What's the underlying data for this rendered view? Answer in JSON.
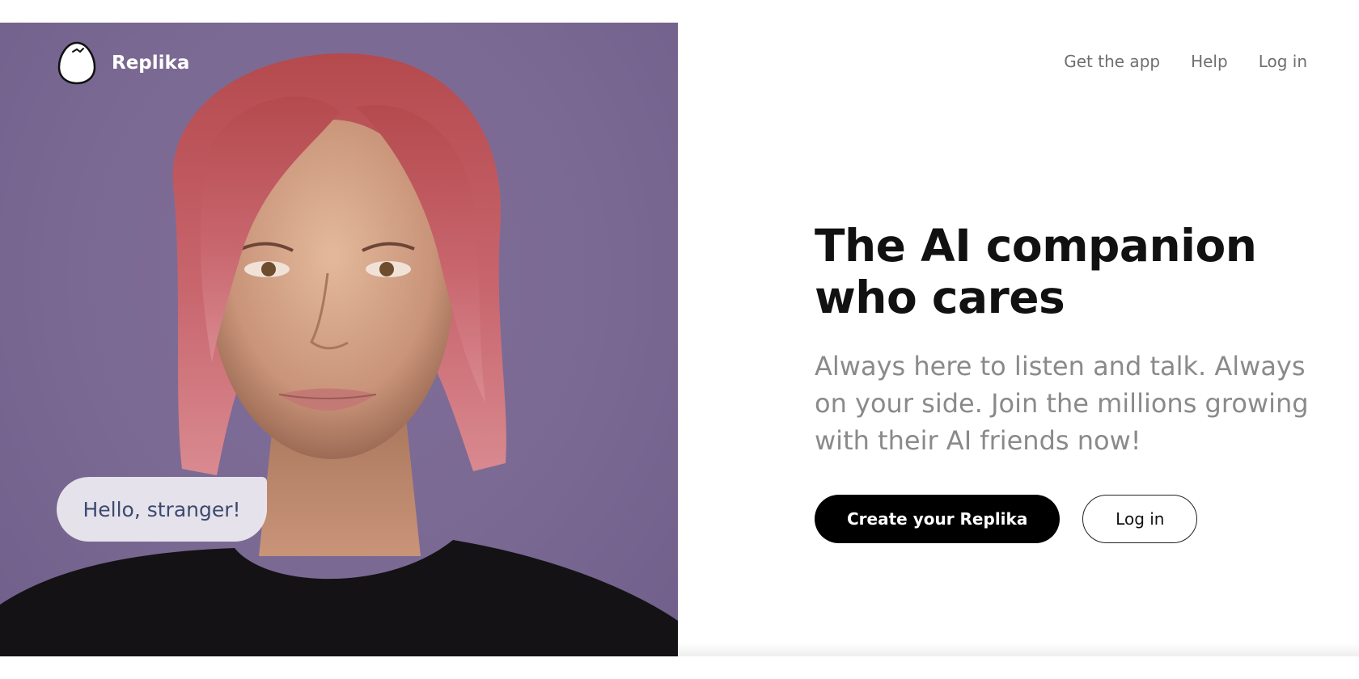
{
  "brand": {
    "name": "Replika",
    "logo_icon": "egg-icon",
    "panel_color": "#7a6993"
  },
  "nav": {
    "items": [
      {
        "label": "Get the app"
      },
      {
        "label": "Help"
      },
      {
        "label": "Log in"
      }
    ]
  },
  "hero": {
    "headline": "The AI companion who cares",
    "subtitle": "Always here to listen and talk. Always on your side. Join the millions growing with their AI friends now!",
    "chat_bubble": "Hello, stranger!",
    "portrait": "avatar-portrait"
  },
  "actions": {
    "primary_label": "Create your Replika",
    "secondary_label": "Log in"
  }
}
